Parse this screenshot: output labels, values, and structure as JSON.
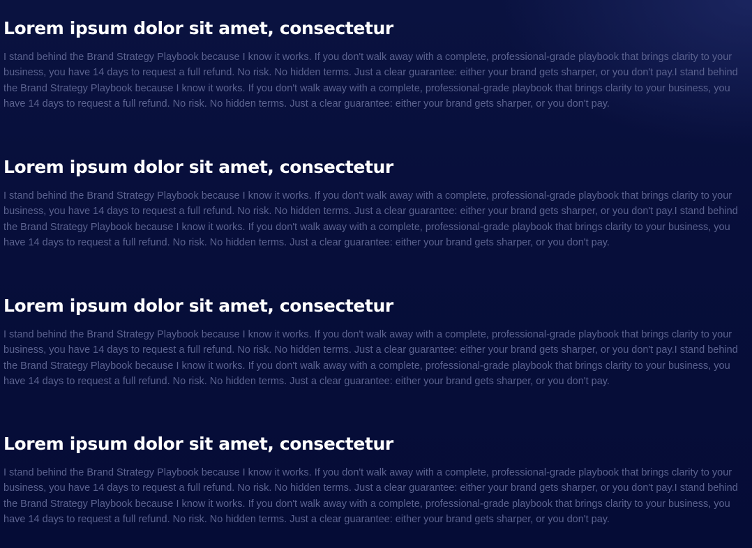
{
  "sections": [
    {
      "title": "Lorem ipsum dolor sit amet, consectetur",
      "body": "I stand behind the Brand Strategy Playbook because I know it works. If you don't walk away with a complete, professional-grade playbook that brings clarity to your business, you have 14 days to request a full refund. No risk. No hidden terms. Just a clear guarantee: either your brand gets sharper, or you don't pay.I stand behind the Brand Strategy Playbook because I know it works. If you don't walk away with a complete, professional-grade playbook that brings clarity to your business, you have 14 days to request a full refund. No risk. No hidden terms. Just a clear guarantee: either your brand gets sharper, or you don't pay."
    },
    {
      "title": "Lorem ipsum dolor sit amet, consectetur",
      "body": "I stand behind the Brand Strategy Playbook because I know it works. If you don't walk away with a complete, professional-grade playbook that brings clarity to your business, you have 14 days to request a full refund. No risk. No hidden terms. Just a clear guarantee: either your brand gets sharper, or you don't pay.I stand behind the Brand Strategy Playbook because I know it works. If you don't walk away with a complete, professional-grade playbook that brings clarity to your business, you have 14 days to request a full refund. No risk. No hidden terms. Just a clear guarantee: either your brand gets sharper, or you don't pay."
    },
    {
      "title": "Lorem ipsum dolor sit amet, consectetur",
      "body": "I stand behind the Brand Strategy Playbook because I know it works. If you don't walk away with a complete, professional-grade playbook that brings clarity to your business, you have 14 days to request a full refund. No risk. No hidden terms. Just a clear guarantee: either your brand gets sharper, or you don't pay.I stand behind the Brand Strategy Playbook because I know it works. If you don't walk away with a complete, professional-grade playbook that brings clarity to your business, you have 14 days to request a full refund. No risk. No hidden terms. Just a clear guarantee: either your brand gets sharper, or you don't pay."
    },
    {
      "title": "Lorem ipsum dolor sit amet, consectetur",
      "body": "I stand behind the Brand Strategy Playbook because I know it works. If you don't walk away with a complete, professional-grade playbook that brings clarity to your business, you have 14 days to request a full refund. No risk. No hidden terms. Just a clear guarantee: either your brand gets sharper, or you don't pay.I stand behind the Brand Strategy Playbook because I know it works. If you don't walk away with a complete, professional-grade playbook that brings clarity to your business, you have 14 days to request a full refund. No risk. No hidden terms. Just a clear guarantee: either your brand gets sharper, or you don't pay."
    }
  ],
  "colors": {
    "background": "#070e3a",
    "title": "#ffffff",
    "body_text": "#5b628f"
  }
}
